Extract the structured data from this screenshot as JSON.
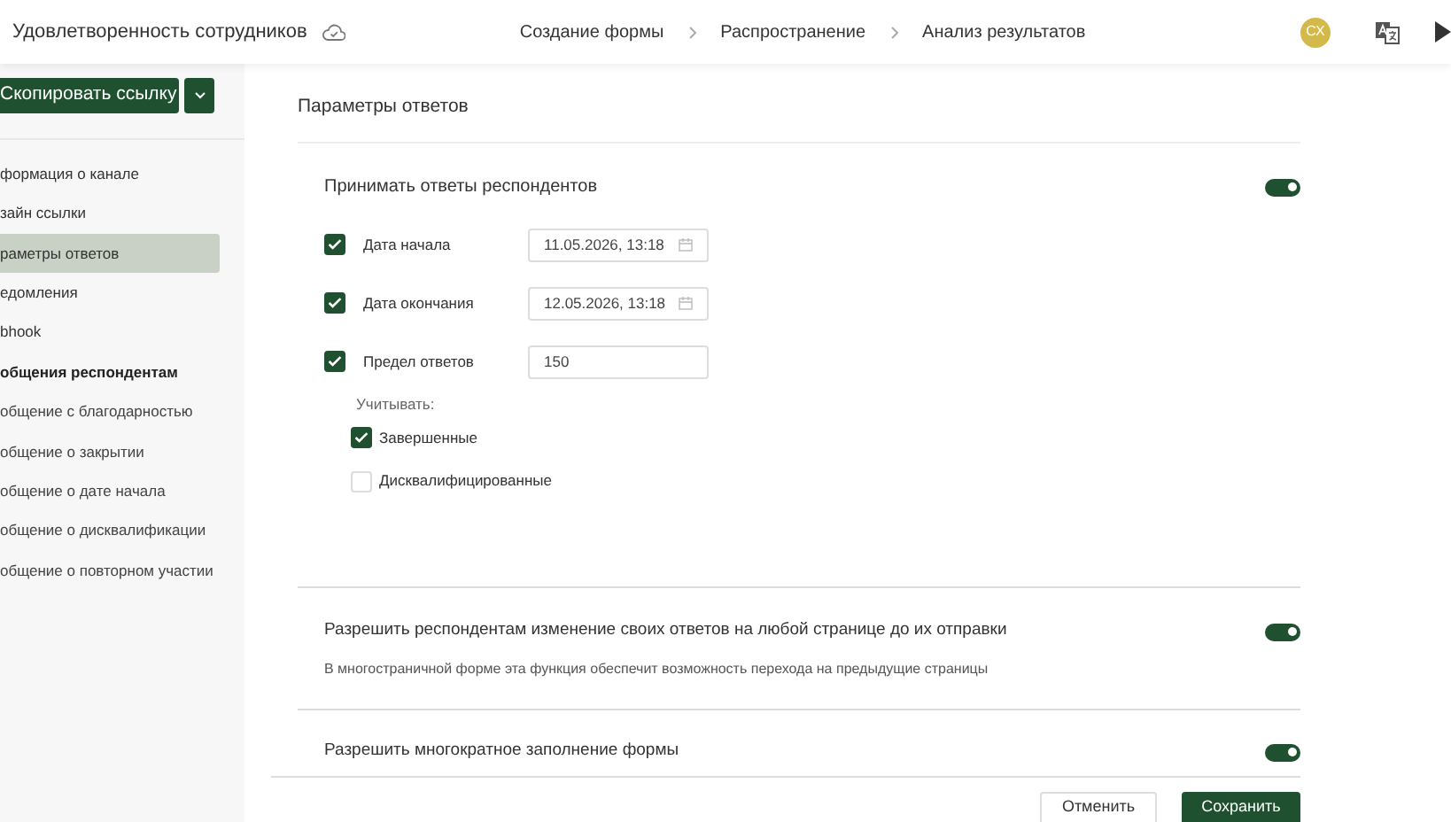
{
  "header": {
    "title": "Удовлетворенность сотрудников",
    "steps": [
      {
        "label": "Создание формы"
      },
      {
        "label": "Распространение"
      },
      {
        "label": "Анализ результатов"
      }
    ],
    "avatar": "СХ"
  },
  "sidebar": {
    "copy_button": "Скопировать ссылку",
    "items": [
      {
        "label": "формация о канале",
        "kind": "group",
        "selected": false
      },
      {
        "label": "зайн ссылки",
        "kind": "group",
        "selected": false
      },
      {
        "label": "раметры ответов",
        "kind": "group",
        "selected": true
      },
      {
        "label": "едомления",
        "kind": "group",
        "selected": false
      },
      {
        "label": "bhook",
        "kind": "group",
        "selected": false
      },
      {
        "label": "общения респондентам",
        "kind": "heading",
        "selected": false
      },
      {
        "label": "общение с благодарностью",
        "kind": "sub",
        "selected": false
      },
      {
        "label": "общение о закрытии",
        "kind": "sub",
        "selected": false
      },
      {
        "label": "общение о дате начала",
        "kind": "sub",
        "selected": false
      },
      {
        "label": "общение о дисквалификации",
        "kind": "sub",
        "selected": false
      },
      {
        "label": "общение о повторном участии",
        "kind": "sub",
        "selected": false
      }
    ]
  },
  "main": {
    "section_title": "Параметры ответов",
    "accept": {
      "label": "Принимать ответы респондентов",
      "on": true
    },
    "limits": [
      {
        "kind": "date",
        "label": "Дата начала",
        "checked": true,
        "value": "11.05.2026, 13:18"
      },
      {
        "kind": "date",
        "label": "Дата окончания",
        "checked": true,
        "value": "12.05.2026, 13:18"
      },
      {
        "kind": "number",
        "label": "Предел ответов",
        "checked": true,
        "value": "150"
      }
    ],
    "count_label": "Учитывать:",
    "count_options": [
      {
        "label": "Завершенные",
        "checked": true
      },
      {
        "label": "Дисквалифицированные",
        "checked": false
      }
    ],
    "settings": [
      {
        "label": "Разрешить респондентам изменение своих ответов на любой странице до их отправки",
        "on": true,
        "description": "В многостраничной форме эта функция обеспечит возможность перехода на предыдущие страницы"
      },
      {
        "label": "Разрешить многократное заполнение формы",
        "on": true
      }
    ],
    "buttons": {
      "cancel": "Отменить",
      "save": "Сохранить"
    }
  }
}
